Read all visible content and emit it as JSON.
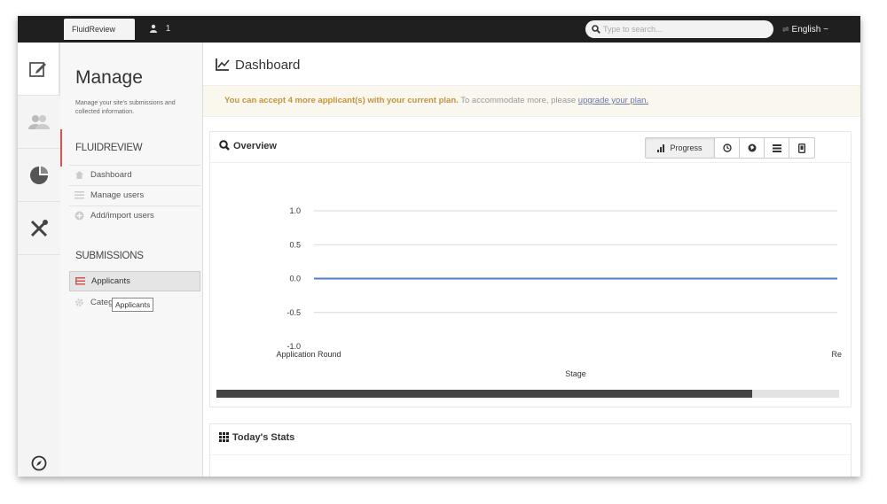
{
  "topbar": {
    "site_tab": "FluidReview",
    "user_count": "1",
    "search_placeholder": "Type to search...",
    "language": "English ~"
  },
  "rail": {
    "icons": [
      "edit-icon",
      "users-icon",
      "pie-chart-icon",
      "tools-icon",
      "compass-icon"
    ]
  },
  "manage": {
    "title": "Manage",
    "description": "Manage your site's submissions and collected information.",
    "section1": "FLUIDREVIEW",
    "section1_items": [
      {
        "label": "Dashboard",
        "icon": "home-icon"
      },
      {
        "label": "Manage users",
        "icon": "list-icon"
      },
      {
        "label": "Add/import users",
        "icon": "plus-circle-icon"
      }
    ],
    "section2": "SUBMISSIONS",
    "section2_items": [
      {
        "label": "Applicants",
        "icon": "list-icon"
      },
      {
        "label": "Categories",
        "icon": "gear-icon"
      }
    ],
    "tooltip": "Applicants"
  },
  "main": {
    "title": "Dashboard",
    "alert_bold": "You can accept 4 more applicant(s) with your current plan.",
    "alert_text": " To accommodate more, please ",
    "alert_link": "upgrade your plan.",
    "overview_title": "Overview",
    "progress_button": "Progress",
    "stats_title": "Today's Stats"
  },
  "chart_data": {
    "type": "line",
    "x": [
      "Application Round",
      "Re"
    ],
    "xlabel": "Stage",
    "ylabel": "",
    "yticks": [
      "1.0",
      "0.5",
      "0.0",
      "-0.5",
      "-1.0"
    ],
    "ylim": [
      -1.0,
      1.0
    ],
    "grid": true,
    "series": [
      {
        "values": [
          0,
          0
        ],
        "color": "#4a7fd0"
      }
    ],
    "scroll_position": 0.86
  }
}
